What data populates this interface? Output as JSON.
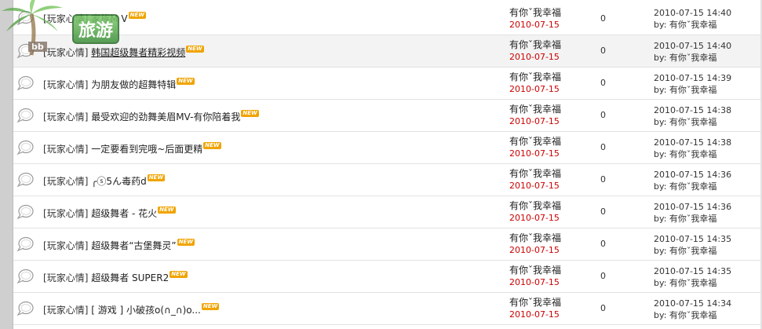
{
  "logo": {
    "text": "旅游",
    "url": "bb"
  },
  "badge_label": "NEW",
  "rows": [
    {
      "category": "玩家心情",
      "title": "家族M V",
      "author": "有你ˇ我幸福",
      "date": "2010-07-15",
      "replies": "0",
      "last_time": "2010-07-15 14:40",
      "last_by": "by: 有你ˇ我幸福",
      "underlined": false,
      "hover": false
    },
    {
      "category": "玩家心情",
      "title": "韩国超级舞者精彩视频",
      "author": "有你ˇ我幸福",
      "date": "2010-07-15",
      "replies": "0",
      "last_time": "2010-07-15 14:40",
      "last_by": "by: 有你ˇ我幸福",
      "underlined": true,
      "hover": true
    },
    {
      "category": "玩家心情",
      "title": "为朋友做的超舞特辑",
      "author": "有你ˇ我幸福",
      "date": "2010-07-15",
      "replies": "0",
      "last_time": "2010-07-15 14:39",
      "last_by": "by: 有你ˇ我幸福",
      "underlined": false,
      "hover": false
    },
    {
      "category": "玩家心情",
      "title": "最受欢迎的劲舞美眉MV-有你陪着我",
      "author": "有你ˇ我幸福",
      "date": "2010-07-15",
      "replies": "0",
      "last_time": "2010-07-15 14:38",
      "last_by": "by: 有你ˇ我幸福",
      "underlined": false,
      "hover": false
    },
    {
      "category": "玩家心情",
      "title": "一定要看到完哦~后面更精",
      "author": "有你ˇ我幸福",
      "date": "2010-07-15",
      "replies": "0",
      "last_time": "2010-07-15 14:38",
      "last_by": "by: 有你ˇ我幸福",
      "underlined": false,
      "hover": false
    },
    {
      "category": "玩家心情",
      "title": "╭ⓢ5ん毒药d",
      "author": "有你ˇ我幸福",
      "date": "2010-07-15",
      "replies": "0",
      "last_time": "2010-07-15 14:36",
      "last_by": "by: 有你ˇ我幸福",
      "underlined": false,
      "hover": false
    },
    {
      "category": "玩家心情",
      "title": "超级舞者 - 花火",
      "author": "有你ˇ我幸福",
      "date": "2010-07-15",
      "replies": "0",
      "last_time": "2010-07-15 14:36",
      "last_by": "by: 有你ˇ我幸福",
      "underlined": false,
      "hover": false
    },
    {
      "category": "玩家心情",
      "title": "超级舞者“古堡舞灵”",
      "author": "有你ˇ我幸福",
      "date": "2010-07-15",
      "replies": "0",
      "last_time": "2010-07-15 14:35",
      "last_by": "by: 有你ˇ我幸福",
      "underlined": false,
      "hover": false
    },
    {
      "category": "玩家心情",
      "title": "超级舞者 SUPER2",
      "author": "有你ˇ我幸福",
      "date": "2010-07-15",
      "replies": "0",
      "last_time": "2010-07-15 14:35",
      "last_by": "by: 有你ˇ我幸福",
      "underlined": false,
      "hover": false
    },
    {
      "category": "玩家心情",
      "title": "[ 游戏 ] 小破孩o(∩_∩)o...",
      "author": "有你ˇ我幸福",
      "date": "2010-07-15",
      "replies": "0",
      "last_time": "2010-07-15 14:34",
      "last_by": "by: 有你ˇ我幸福",
      "underlined": false,
      "hover": false
    }
  ]
}
